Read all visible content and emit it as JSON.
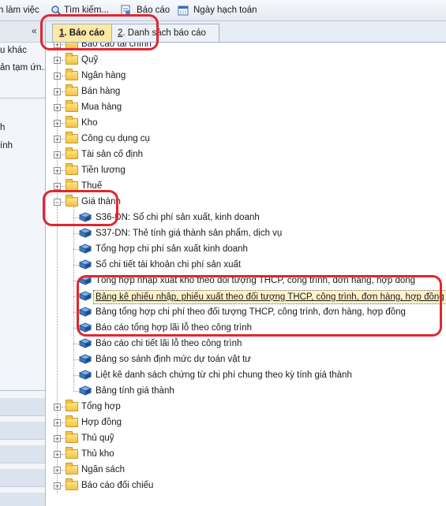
{
  "toolbar": {
    "items": [
      {
        "label": "h làm việc",
        "icon": "workspace-icon"
      },
      {
        "label": "Tìm kiếm...",
        "icon": "search-icon"
      },
      {
        "label": "Báo cáo",
        "icon": "report-icon"
      },
      {
        "label": "Ngày hạch toán",
        "icon": "calendar-icon"
      }
    ]
  },
  "left_pane": {
    "collapse_glyph": "«",
    "lines": [
      "u khác",
      "ản tạm ứn...",
      "h",
      "ính"
    ]
  },
  "tabs": [
    {
      "number": "1",
      "rest": ". Báo cáo",
      "active": true
    },
    {
      "number": "2",
      "rest": ". Danh sách báo cáo",
      "active": false
    }
  ],
  "tree": {
    "top_group": "Báo cáo tài chính",
    "groups_before": [
      "Quỹ",
      "Ngân hàng",
      "Bán hàng",
      "Mua hàng",
      "Kho",
      "Công cụ dụng cụ",
      "Tài sản cố định",
      "Tiền lương",
      "Thuế"
    ],
    "expanded_group": "Giá thành",
    "reports": [
      "S36-DN: Sổ chi phí sản xuất, kinh doanh",
      "S37-DN: Thẻ tính giá thành sản phẩm, dịch vụ",
      "Tổng hợp chi phí sản xuất kinh doanh",
      "Sổ chi tiết tài khoản chi phí sản xuất",
      "Tổng hợp nhập xuất kho theo đối tượng THCP, công trình, đơn hàng, hợp đồng",
      "Bảng kê phiếu nhập, phiếu xuất theo đối tượng THCP, công trình, đơn hàng, hợp đồng",
      "Bảng tổng hợp chi phí theo đối tượng THCP, công trình, đơn hàng, hợp đồng",
      "Báo cáo tổng hợp lãi lỗ theo công trình",
      "Báo cáo chi tiết lãi lỗ theo công trình",
      "Bảng so sánh định mức dự toán vật tư",
      "Liệt kê danh sách chứng từ chi phí chung theo kỳ tính giá thành",
      "Bảng tính giá thành"
    ],
    "selected_index": 5,
    "groups_after": [
      "Tổng hợp",
      "Hợp đồng",
      "Thủ quỹ",
      "Thủ kho",
      "Ngân sách",
      "Báo cáo đối chiếu"
    ],
    "expand_glyph": "+",
    "collapse_glyph": "−"
  },
  "colors": {
    "annotation_red": "#e0272e",
    "active_tab": "#fde8a4",
    "folder": "#f3c246"
  }
}
